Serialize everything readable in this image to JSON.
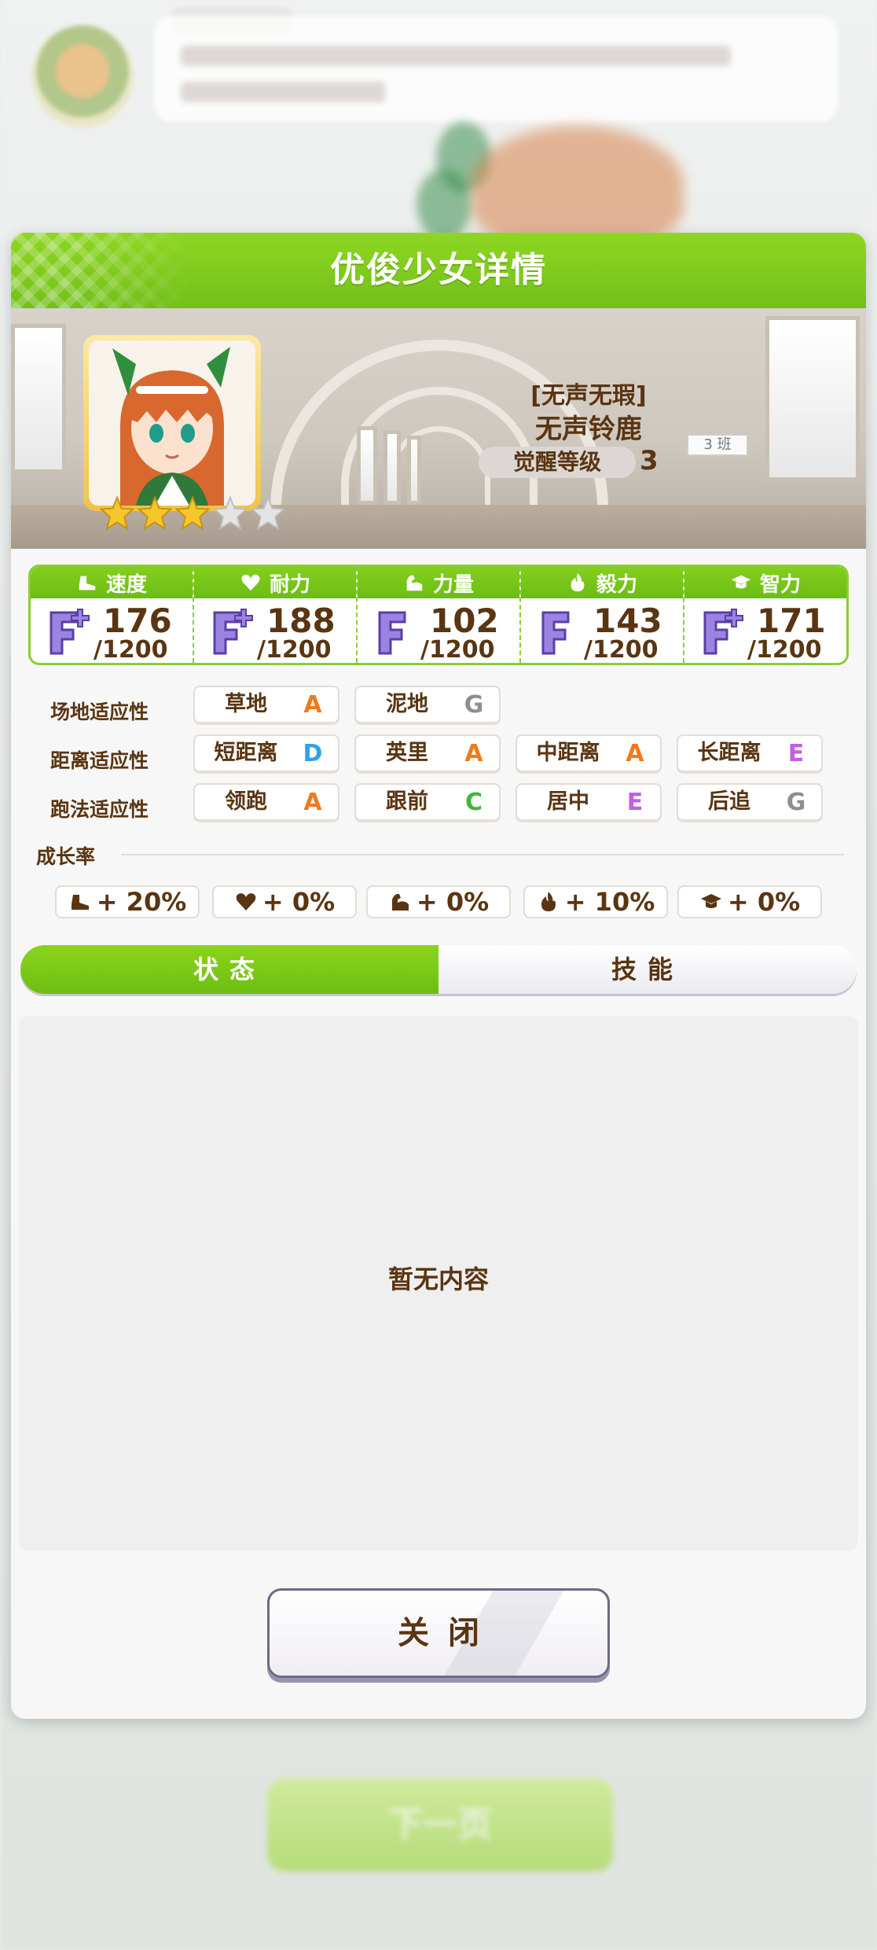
{
  "dialog": {
    "title": "优俊少女详情"
  },
  "character": {
    "epithet": "[无声无瑕]",
    "name": "无声铃鹿",
    "awaken_label": "觉醒等级",
    "awaken_level": "3",
    "stars_filled": 3,
    "stars_total": 5,
    "class_sign": "3 班"
  },
  "stats": [
    {
      "name": "速度",
      "icon": "shoe-icon",
      "grade": "F+",
      "value": "176",
      "max": "/1200"
    },
    {
      "name": "耐力",
      "icon": "heart-icon",
      "grade": "F+",
      "value": "188",
      "max": "/1200"
    },
    {
      "name": "力量",
      "icon": "muscle-icon",
      "grade": "F",
      "value": "102",
      "max": "/1200"
    },
    {
      "name": "毅力",
      "icon": "flame-icon",
      "grade": "F",
      "value": "143",
      "max": "/1200"
    },
    {
      "name": "智力",
      "icon": "grad-cap-icon",
      "grade": "F+",
      "value": "171",
      "max": "/1200"
    }
  ],
  "aptitude": {
    "track_label": "场地适应性",
    "distance_label": "距离适应性",
    "style_label": "跑法适应性",
    "track": [
      {
        "name": "草地",
        "grade": "A"
      },
      {
        "name": "泥地",
        "grade": "G"
      }
    ],
    "distance": [
      {
        "name": "短距离",
        "grade": "D"
      },
      {
        "name": "英里",
        "grade": "A"
      },
      {
        "name": "中距离",
        "grade": "A"
      },
      {
        "name": "长距离",
        "grade": "E"
      }
    ],
    "style": [
      {
        "name": "领跑",
        "grade": "A"
      },
      {
        "name": "跟前",
        "grade": "C"
      },
      {
        "name": "居中",
        "grade": "E"
      },
      {
        "name": "后追",
        "grade": "G"
      }
    ]
  },
  "growth": {
    "label": "成长率",
    "items": [
      "+ 20%",
      "+ 0%",
      "+ 0%",
      "+ 10%",
      "+ 0%"
    ]
  },
  "tabs": {
    "status": "状态",
    "skills": "技能",
    "active": "status"
  },
  "content": {
    "empty_text": "暂无内容"
  },
  "buttons": {
    "close": "关闭",
    "next": "下一页"
  },
  "colors": {
    "accent_green": "#78c41a",
    "grade_A": "#f07a1c",
    "grade_C": "#3db83a",
    "grade_D": "#2ea3e6",
    "grade_E": "#c45ee0",
    "grade_G": "#8e8e8e",
    "text_brown": "#5a3512"
  }
}
